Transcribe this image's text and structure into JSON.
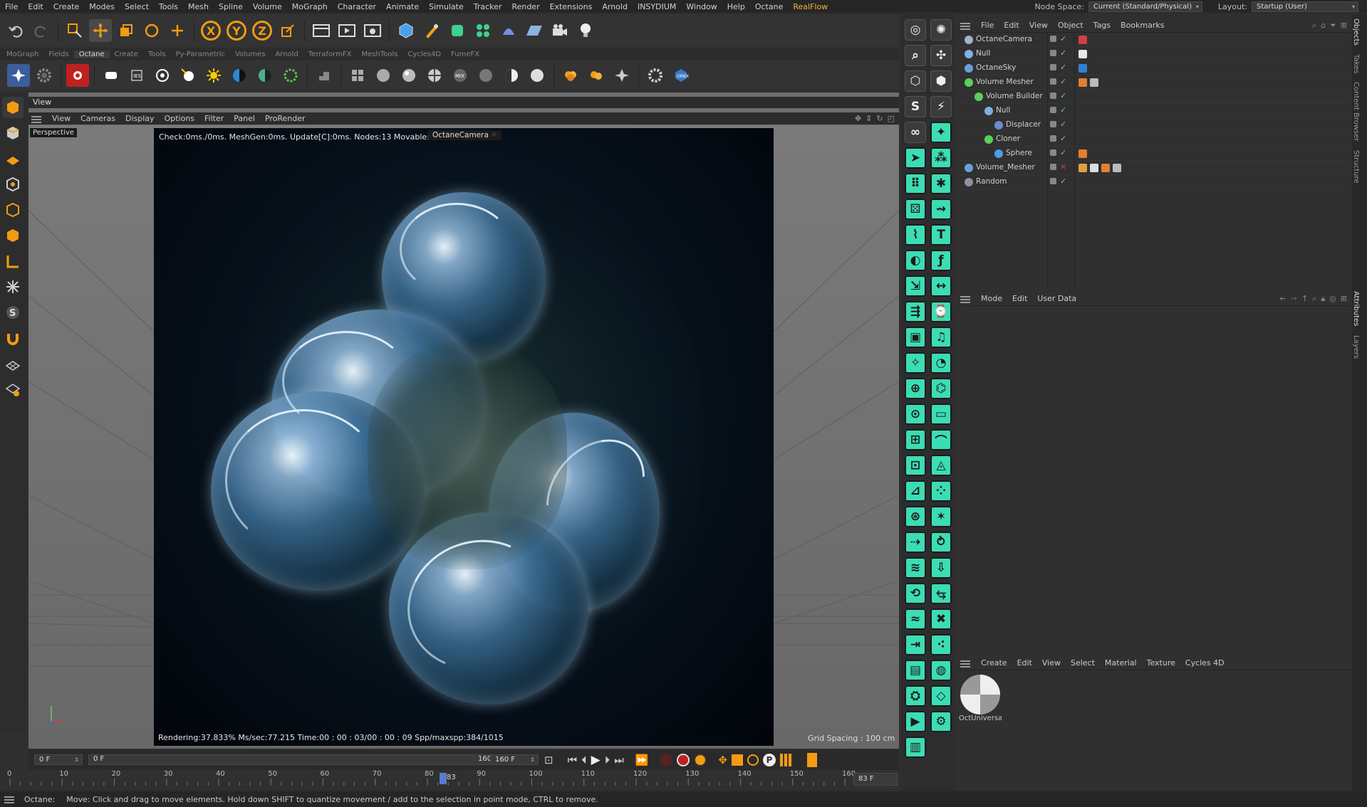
{
  "menubar": {
    "items": [
      "File",
      "Edit",
      "Create",
      "Modes",
      "Select",
      "Tools",
      "Mesh",
      "Spline",
      "Volume",
      "MoGraph",
      "Character",
      "Animate",
      "Simulate",
      "Tracker",
      "Render",
      "Extensions",
      "Arnold",
      "INSYDIUM",
      "Window",
      "Help",
      "Octane",
      "RealFlow"
    ],
    "node_space_label": "Node Space:",
    "node_space_value": "Current (Standard/Physical)",
    "layout_label": "Layout:",
    "layout_value": "Startup (User)"
  },
  "toolbar1": {
    "icons": [
      "undo-icon",
      "redo-icon",
      "live-selection-icon",
      "move-icon",
      "scale-icon",
      "rotate-icon",
      "transform-icon",
      "x-axis-lock",
      "y-axis-lock",
      "z-axis-lock",
      "coordinate-system-icon",
      "render-region-icon",
      "render-view-icon",
      "render-settings-icon",
      "cube-icon",
      "pen-icon",
      "subdivision-icon",
      "cloner-icon",
      "deformer-icon",
      "floor-icon",
      "camera-icon",
      "light-icon"
    ],
    "axis_labels": [
      "X",
      "Y",
      "Z"
    ]
  },
  "module_tabs": {
    "items": [
      "MoGraph",
      "Fields",
      "Octane",
      "Create",
      "Tools",
      "Py-Parametric",
      "Volumes",
      "Arnold",
      "TerraformFX",
      "MeshTools",
      "Cycles4D",
      "FumeFX"
    ],
    "active": "Octane"
  },
  "octane_toolbar": {
    "icons": [
      "octane-settings-icon",
      "octane-gear-icon",
      "live-viewer-icon",
      "area-light-icon",
      "ies-light-icon",
      "target-light-icon",
      "spot-light-icon",
      "sun-light-icon",
      "daylight-icon",
      "hdri-icon",
      "texture-environment-icon",
      "camera-imager-icon",
      "material-grid-icon",
      "diffuse-material-icon",
      "glossy-material-icon",
      "specular-material-icon",
      "mix-material-icon",
      "metal-material-icon",
      "toon-material-icon",
      "universal-material-icon",
      "fog-volume-icon",
      "vdb-volume-icon",
      "scatter-icon",
      "octane-options-icon",
      "orbx-icon"
    ]
  },
  "viewport": {
    "tab": "View",
    "menu": [
      "View",
      "Cameras",
      "Display",
      "Options",
      "Filter",
      "Panel",
      "ProRender"
    ],
    "mode_label": "Perspective",
    "camera_label": "OctaneCamera",
    "check_text": "Check:0ms./0ms. MeshGen:0ms. Update[C]:0ms. Nodes:13 Movable:1",
    "render_status": "Rendering:37.833% Ms/sec:77.215 Time:00 : 00 : 03/00 : 00 : 09 Spp/maxspp:384/1015",
    "grid_spacing": "Grid Spacing : 100 cm"
  },
  "timeline": {
    "start_frame": "0 F",
    "min_frame": "0 F",
    "max_frame": "160 F",
    "end_frame": "160 F",
    "current_frame": "83 F",
    "ruler_ticks": [
      "0",
      "10",
      "20",
      "30",
      "40",
      "50",
      "60",
      "70",
      "80",
      "90",
      "100",
      "110",
      "120",
      "130",
      "140",
      "150",
      "160"
    ],
    "playhead_label": "83",
    "playhead_frame": 83,
    "frame_range": [
      0,
      160
    ]
  },
  "statusbar": {
    "prefix": "Octane:",
    "message": "Move: Click and drag to move elements. Hold down SHIFT to quantize movement / add to the selection in point mode, CTRL to remove."
  },
  "object_manager": {
    "menu": [
      "File",
      "Edit",
      "View",
      "Object",
      "Tags",
      "Bookmarks"
    ],
    "objects": [
      {
        "name": "OctaneCamera",
        "level": 0,
        "icon_color": "#9fb4c8",
        "tags": [
          "#d04040"
        ]
      },
      {
        "name": "Null",
        "level": 0,
        "icon_color": "#7fb0e0",
        "tags": [
          "#e8e8e8"
        ]
      },
      {
        "name": "OctaneSky",
        "level": 0,
        "icon_color": "#6aa0d8",
        "tags": [
          "#3080d0"
        ]
      },
      {
        "name": "Volume Mesher",
        "level": 0,
        "icon_color": "#5ad05a",
        "tags": [
          "#e08030",
          "#bbbbbb"
        ]
      },
      {
        "name": "Volume Builder",
        "level": 1,
        "icon_color": "#5ad05a",
        "tags": []
      },
      {
        "name": "Null",
        "level": 2,
        "icon_color": "#7fb0e0",
        "tags": []
      },
      {
        "name": "Displacer",
        "level": 3,
        "icon_color": "#6a8ad8",
        "tags": []
      },
      {
        "name": "Cloner",
        "level": 2,
        "icon_color": "#5ad05a",
        "tags": []
      },
      {
        "name": "Sphere",
        "level": 3,
        "icon_color": "#4aa0e8",
        "tags": [
          "#e08030"
        ]
      },
      {
        "name": "Volume_Mesher",
        "level": 0,
        "icon_color": "#6aa0d8",
        "tags": [
          "#e0a040",
          "#dddddd",
          "#e08030",
          "#bbbbbb"
        ]
      },
      {
        "name": "Random",
        "level": 0,
        "icon_color": "#9090a0",
        "tags": []
      }
    ]
  },
  "attribute_manager": {
    "menu": [
      "Mode",
      "Edit",
      "User Data"
    ]
  },
  "material_manager": {
    "menu": [
      "Create",
      "Edit",
      "View",
      "Select",
      "Material",
      "Texture",
      "Cycles 4D"
    ],
    "materials": [
      "OctUniversal"
    ]
  },
  "side_tabs": [
    "Objects",
    "Takes",
    "Content Browser",
    "Structure",
    "Attributes",
    "Layers"
  ],
  "colors": {
    "accent_orange": "#f39c12",
    "mograph_green": "#3cdcb4",
    "realflow": "#f2b632",
    "render_bg": "#06101a"
  }
}
